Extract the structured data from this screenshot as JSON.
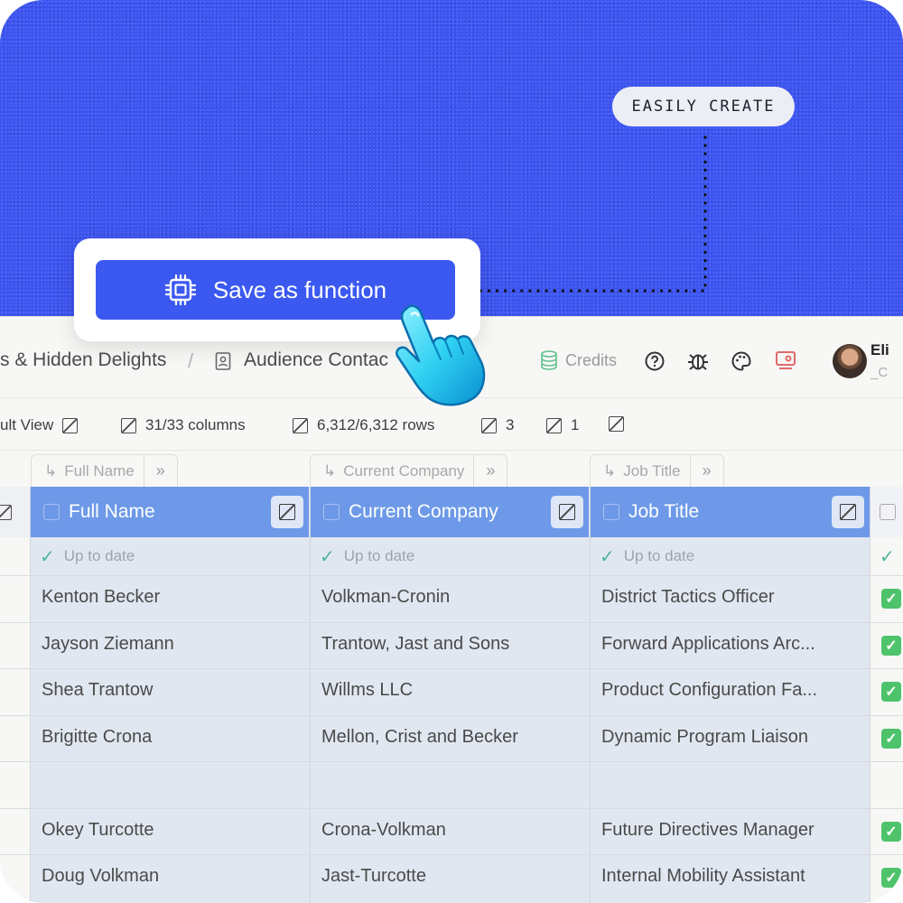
{
  "hero": {
    "badge": "EASILY CREATE",
    "background_color": "#3d55f2"
  },
  "save_card": {
    "button_label": "Save as function",
    "button_color": "#3b59f0",
    "icon": "cpu-chip-icon"
  },
  "nav": {
    "breadcrumb_1": "s & Hidden Delights",
    "breadcrumb_sep": "/",
    "breadcrumb_2": "Audience Contac",
    "credits_label": "Credits",
    "user_name": "Eli",
    "user_sub": "_C",
    "icons": [
      "help-icon",
      "bug-icon",
      "palette-icon",
      "view-toggle-icon"
    ]
  },
  "toolbar": {
    "view": "ult View",
    "columns": "31/33 columns",
    "rows": "6,312/6,312 rows",
    "count_a": "3",
    "count_b": "1"
  },
  "groups": [
    {
      "label": "Full Name"
    },
    {
      "label": "Current Company"
    },
    {
      "label": "Job Title"
    }
  ],
  "table": {
    "headers": [
      "Full Name",
      "Current Company",
      "Job Title"
    ],
    "status_text": "Up to date",
    "header_color": "#6d99e8",
    "rows": [
      {
        "name": "Kenton Becker",
        "company": "Volkman-Cronin",
        "title": "District Tactics Officer",
        "done": true
      },
      {
        "name": "Jayson Ziemann",
        "company": "Trantow, Jast and Sons",
        "title": "Forward Applications Arc...",
        "done": true
      },
      {
        "name": "Shea Trantow",
        "company": "Willms LLC",
        "title": "Product Configuration Fa...",
        "done": true
      },
      {
        "name": "Brigitte Crona",
        "company": "Mellon, Crist and Becker",
        "title": "Dynamic Program Liaison",
        "done": true
      },
      {
        "name": "",
        "company": "",
        "title": "",
        "done": false
      },
      {
        "name": "Okey Turcotte",
        "company": "Crona-Volkman",
        "title": "Future Directives Manager",
        "done": true
      },
      {
        "name": "Doug Volkman",
        "company": "Jast-Turcotte",
        "title": "Internal Mobility Assistant",
        "done": true
      }
    ]
  }
}
